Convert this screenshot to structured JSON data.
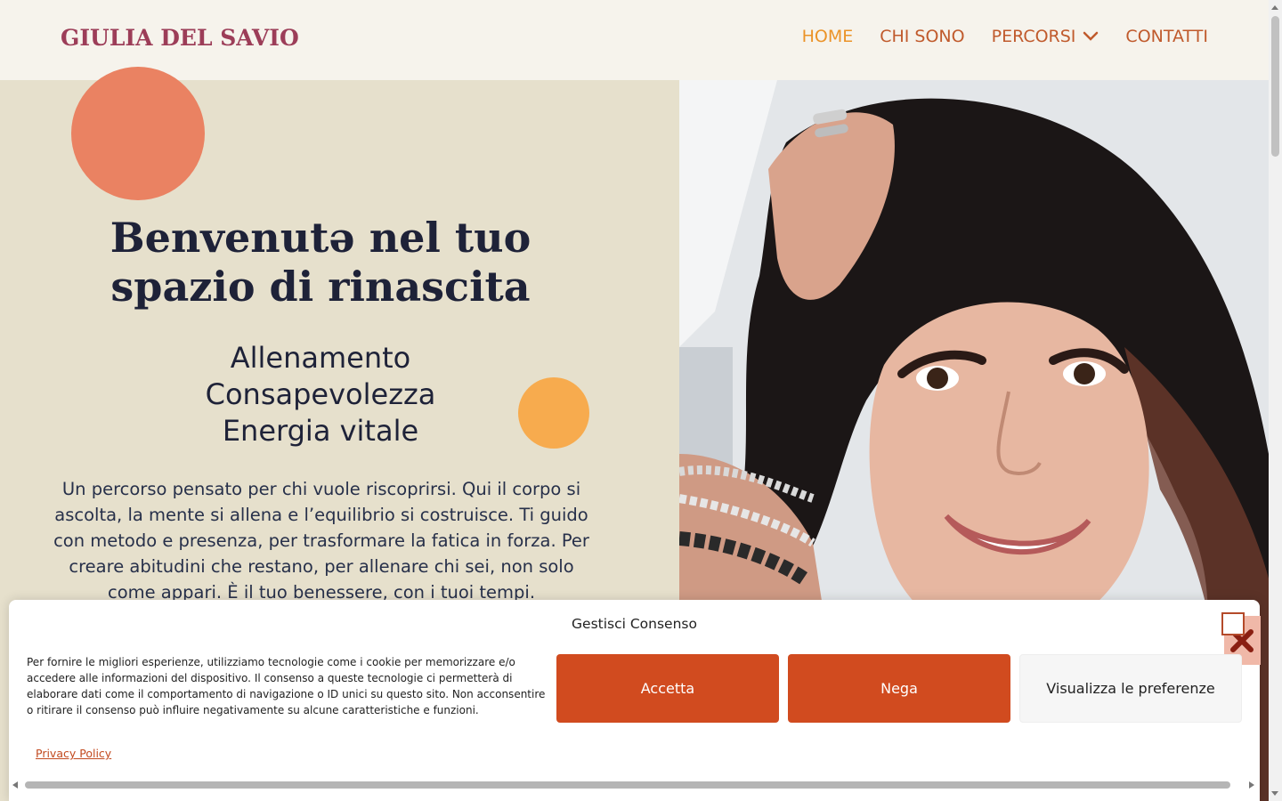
{
  "header": {
    "logo": "GIULIA DEL SAVIO",
    "nav": [
      {
        "label": "HOME",
        "active": true
      },
      {
        "label": "CHI SONO",
        "active": false
      },
      {
        "label": "PERCORSI",
        "active": false,
        "has_dropdown": true
      },
      {
        "label": "CONTATTI",
        "active": false
      }
    ]
  },
  "hero": {
    "title": "Benvenutə nel tuo spazio di rinascita",
    "subtitle_lines": [
      "Allenamento",
      "Consapevolezza",
      "Energia vitale"
    ],
    "body": "Un percorso pensato per chi vuole riscoprirsi. Qui il corpo si ascolta, la mente si allena e l’equilibrio si costruisce. Ti guido con metodo e presenza, per trasformare la fatica in forza. Per creare abitudini che restano, per allenare chi sei, non solo come appari. È il tuo benessere, con i tuoi tempi."
  },
  "cookie": {
    "title": "Gestisci Consenso",
    "text": "Per fornire le migliori esperienze, utilizziamo tecnologie come i cookie per memorizzare e/o accedere alle informazioni del dispositivo. Il consenso a queste tecnologie ci permetterà di elaborare dati come il comportamento di navigazione o ID unici su questo sito. Non acconsentire o ritirare il consenso può influire negativamente su alcune caratteristiche e funzioni.",
    "accept_label": "Accetta",
    "deny_label": "Nega",
    "prefs_label": "Visualizza le preferenze",
    "privacy_label": "Privacy Policy"
  },
  "colors": {
    "brand": "#9c3d58",
    "nav": "#c05a2c",
    "nav_active": "#eb9328",
    "accent_button": "#d14b1f",
    "hero_bg": "#e6e0cc"
  }
}
